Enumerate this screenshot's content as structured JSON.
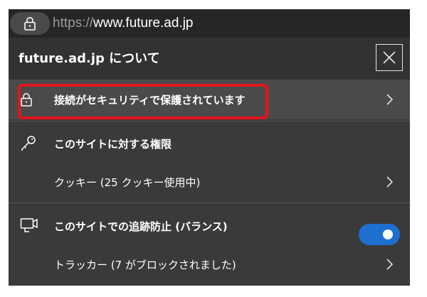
{
  "address_bar": {
    "url_scheme": "https://",
    "url_host": "www.future.ad.jp",
    "lock_icon": "lock-icon"
  },
  "panel": {
    "title": "future.ad.jp について",
    "close_icon": "close-icon"
  },
  "connection": {
    "label": "接続がセキュリティで保護されています",
    "icon": "lock-icon",
    "highlight_color": "#e3141b"
  },
  "permissions": {
    "heading": "このサイトに対する権限",
    "icon": "key-icon",
    "cookies_label": "クッキー (25 クッキー使用中)"
  },
  "tracking": {
    "heading": "このサイトでの追跡防止 (バランス)",
    "icon": "tracking-camera-icon",
    "toggle_on": true,
    "toggle_color": "#1e6fd0",
    "trackers_label": "トラッカー (7 がブロックされました)"
  }
}
